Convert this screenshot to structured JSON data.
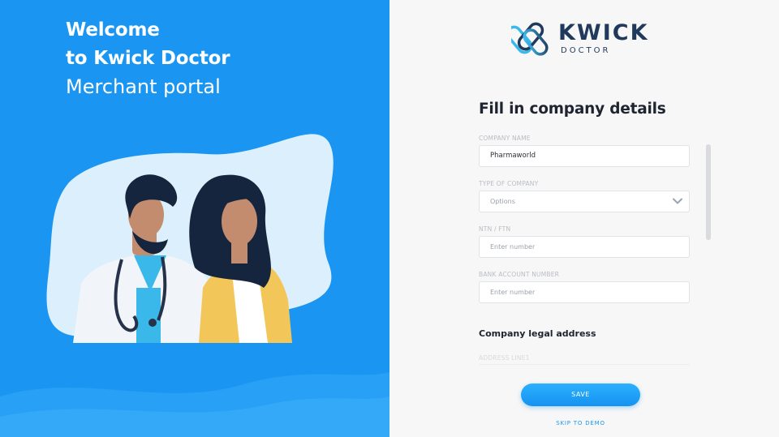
{
  "hero": {
    "welcome_line1": "Welcome",
    "welcome_line2": "to Kwick Doctor",
    "welcome_line3": "Merchant portal",
    "background_color": "#1a96f2"
  },
  "brand": {
    "name": "KWICK",
    "sub": "DOCTOR",
    "color": "#1f3a5a",
    "logo_icon": "kwick-doctor-logo-icon"
  },
  "form": {
    "title": "Fill in company details",
    "fields": [
      {
        "label": "COMPANY NAME",
        "value": "Pharmaworld",
        "placeholder": ""
      },
      {
        "label": "TYPE OF COMPANY",
        "value": "",
        "placeholder": "Options",
        "icon": "chevron-down-icon"
      },
      {
        "label": "NTN / FTN",
        "value": "",
        "placeholder": "Enter number"
      },
      {
        "label": "BANK ACCOUNT NUMBER",
        "value": "",
        "placeholder": "Enter number"
      }
    ],
    "address_section": {
      "title": "Company legal address",
      "first_label": "ADDRESS LINE1"
    }
  },
  "actions": {
    "save_label": "SAVE",
    "skip_label": "SKIP TO DEMO",
    "accent": "#1a96f2"
  }
}
